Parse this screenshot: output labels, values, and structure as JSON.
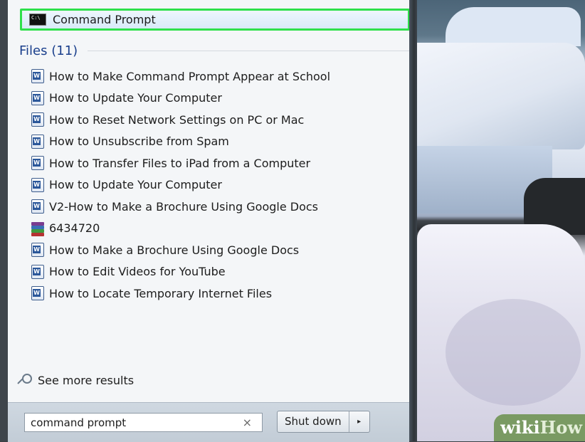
{
  "programs": {
    "command_prompt_label": "Command Prompt"
  },
  "files_section": {
    "title": "Files (11)",
    "items": [
      {
        "label": "How to Make Command Prompt Appear at School",
        "icon": "word-document-icon"
      },
      {
        "label": "How to Update Your Computer",
        "icon": "word-document-icon"
      },
      {
        "label": "How to Reset Network Settings on PC or Mac",
        "icon": "word-document-icon"
      },
      {
        "label": "How to Unsubscribe from Spam",
        "icon": "word-document-icon"
      },
      {
        "label": "How to Transfer Files to iPad from a Computer",
        "icon": "word-document-icon"
      },
      {
        "label": "How to Update Your Computer",
        "icon": "word-document-icon"
      },
      {
        "label": "V2-How to Make a Brochure Using Google Docs",
        "icon": "word-document-icon"
      },
      {
        "label": "6434720",
        "icon": "archive-icon"
      },
      {
        "label": "How to Make a Brochure Using Google Docs",
        "icon": "word-document-icon"
      },
      {
        "label": "How to Edit Videos for YouTube",
        "icon": "word-document-icon"
      },
      {
        "label": "How to Locate Temporary Internet Files",
        "icon": "word-document-icon"
      }
    ]
  },
  "see_more": {
    "label": "See more results"
  },
  "search": {
    "value": "command prompt",
    "clear_symbol": "×"
  },
  "power": {
    "shutdown_label": "Shut down",
    "arrow_symbol": "▸"
  },
  "watermark": {
    "part1": "wiki",
    "part2": "How"
  },
  "colors": {
    "highlight_border": "#2ee04b",
    "section_title": "#1a3f8c"
  }
}
